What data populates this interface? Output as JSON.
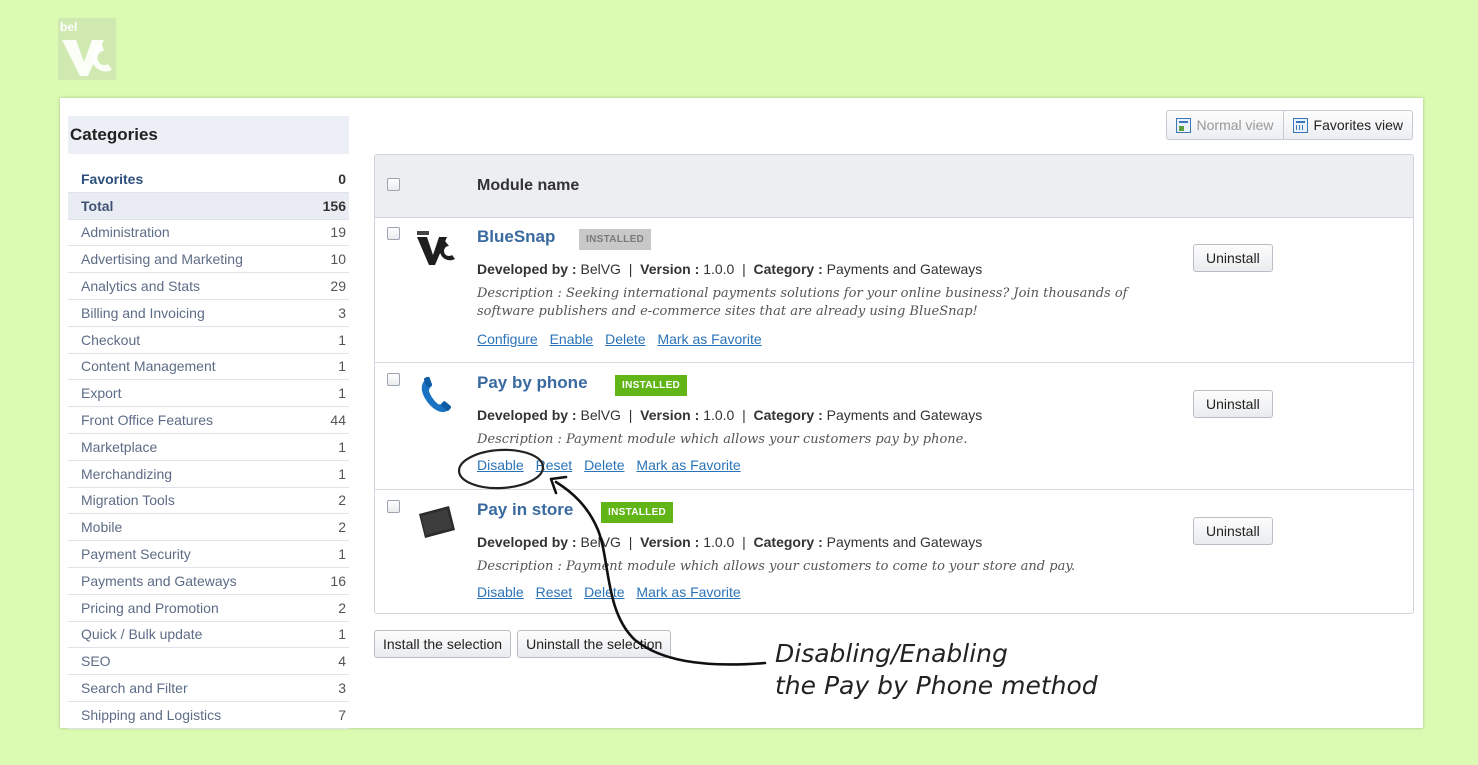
{
  "sidebar": {
    "title": "Categories",
    "items": [
      {
        "label": "Favorites",
        "count": "0"
      },
      {
        "label": "Total",
        "count": "156"
      },
      {
        "label": "Administration",
        "count": "19"
      },
      {
        "label": "Advertising and Marketing",
        "count": "10"
      },
      {
        "label": "Analytics and Stats",
        "count": "29"
      },
      {
        "label": "Billing and Invoicing",
        "count": "3"
      },
      {
        "label": "Checkout",
        "count": "1"
      },
      {
        "label": "Content Management",
        "count": "1"
      },
      {
        "label": "Export",
        "count": "1"
      },
      {
        "label": "Front Office Features",
        "count": "44"
      },
      {
        "label": "Marketplace",
        "count": "1"
      },
      {
        "label": "Merchandizing",
        "count": "1"
      },
      {
        "label": "Migration Tools",
        "count": "2"
      },
      {
        "label": "Mobile",
        "count": "2"
      },
      {
        "label": "Payment Security",
        "count": "1"
      },
      {
        "label": "Payments and Gateways",
        "count": "16"
      },
      {
        "label": "Pricing and Promotion",
        "count": "2"
      },
      {
        "label": "Quick / Bulk update",
        "count": "1"
      },
      {
        "label": "SEO",
        "count": "4"
      },
      {
        "label": "Search and Filter",
        "count": "3"
      },
      {
        "label": "Shipping and Logistics",
        "count": "7"
      }
    ]
  },
  "views": {
    "normal": "Normal view",
    "favorites": "Favorites view"
  },
  "table": {
    "header": "Module name"
  },
  "meta_labels": {
    "developed_by": "Developed by :",
    "version": "Version :",
    "category": "Category :"
  },
  "modules": [
    {
      "name": "BlueSnap",
      "badge": "INSTALLED",
      "developer": "BelVG",
      "version": "1.0.0",
      "category": "Payments and Gateways",
      "description": "Description : Seeking international payments solutions for your online business? Join thousands of software publishers and e-commerce sites that are already using BlueSnap!",
      "actions": [
        "Configure",
        "Enable",
        "Delete",
        "Mark as Favorite"
      ],
      "button": "Uninstall"
    },
    {
      "name": "Pay by phone",
      "badge": "INSTALLED",
      "developer": "BelVG",
      "version": "1.0.0",
      "category": "Payments and Gateways",
      "description": "Description : Payment module which allows your customers pay by phone.",
      "actions": [
        "Disable",
        "Reset",
        "Delete",
        "Mark as Favorite"
      ],
      "button": "Uninstall"
    },
    {
      "name": "Pay in store",
      "badge": "INSTALLED",
      "developer": "BelVG",
      "version": "1.0.0",
      "category": "Payments and Gateways",
      "description": "Description : Payment module which allows your customers to come to your store and pay.",
      "actions": [
        "Disable",
        "Reset",
        "Delete",
        "Mark as Favorite"
      ],
      "button": "Uninstall"
    }
  ],
  "bottom": {
    "install": "Install the selection",
    "uninstall": "Uninstall the selection"
  },
  "annotation": {
    "line1": "Disabling/Enabling",
    "line2": "the Pay by Phone method"
  },
  "logo": {
    "text": "bel"
  },
  "colors": {
    "background": "#dbfbb3",
    "link": "#2b73b8",
    "installed_green": "#61b517",
    "installed_gray": "#c8c8c8"
  }
}
